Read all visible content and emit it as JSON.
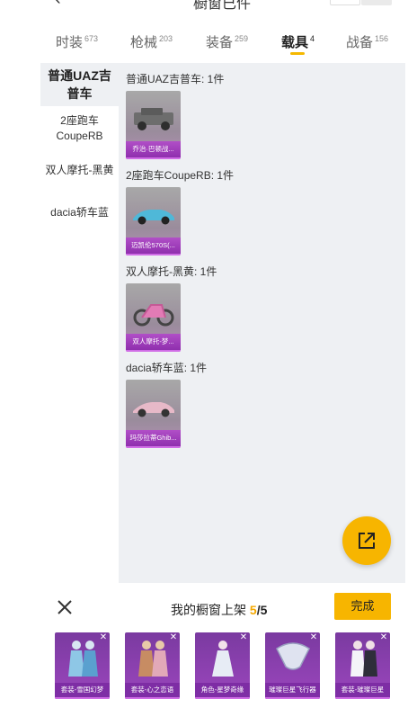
{
  "header": {
    "title": "橱窗已件"
  },
  "tabs": [
    {
      "label": "时装",
      "count": "673"
    },
    {
      "label": "枪械",
      "count": "203"
    },
    {
      "label": "装备",
      "count": "259"
    },
    {
      "label": "载具",
      "count": "4"
    },
    {
      "label": "战备",
      "count": "156"
    }
  ],
  "sidebar": {
    "items": [
      {
        "label": "普通UAZ吉普车"
      },
      {
        "label": "2座跑车CoupeRB"
      },
      {
        "label": "双人摩托-黑黄"
      },
      {
        "label": "dacia轿车蓝"
      }
    ]
  },
  "groups": [
    {
      "label": "普通UAZ吉普车: 1件",
      "card_caption": "乔治·巴顿战..."
    },
    {
      "label": "2座跑车CoupeRB: 1件",
      "card_caption": "迈凯伦570S(..."
    },
    {
      "label": "双人摩托-黑黄: 1件",
      "card_caption": "双人摩托-梦..."
    },
    {
      "label": "dacia轿车蓝: 1件",
      "card_caption": "玛莎拉蒂Ghib..."
    }
  ],
  "shelf": {
    "title": "我的橱窗上架",
    "count": "5",
    "sep": "/",
    "total": "5",
    "done_label": "完成",
    "items": [
      {
        "caption": "套装-雪国幻梦"
      },
      {
        "caption": "套装-心之恋语"
      },
      {
        "caption": "角色-星梦奇缘"
      },
      {
        "caption": "璀璨巨星飞行器"
      },
      {
        "caption": "套装-璀璨巨星"
      }
    ]
  },
  "colors": {
    "accent": "#f7b500",
    "panel_bg": "#eef0f3",
    "card_caption": "#9b3fbf"
  },
  "icons": {
    "share": "share-out-icon",
    "close": "close-icon",
    "back": "chevron-left-icon"
  }
}
